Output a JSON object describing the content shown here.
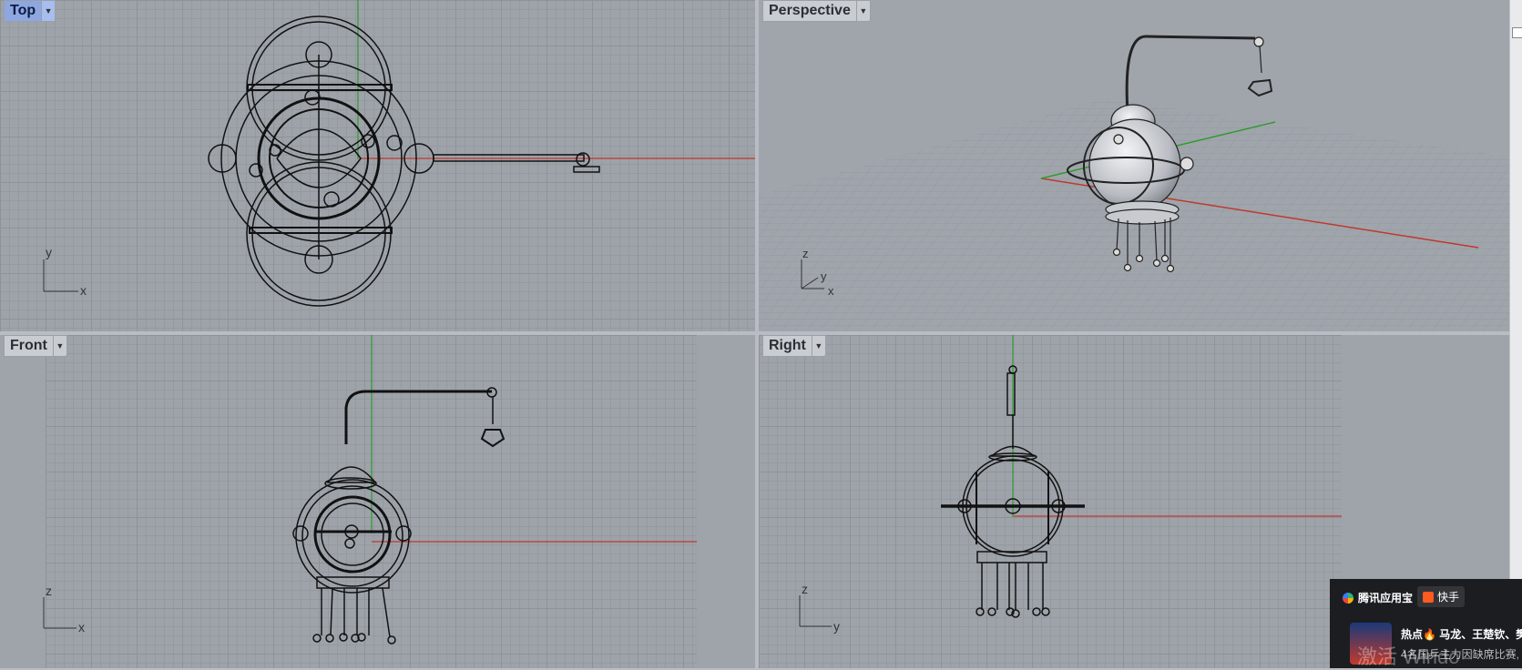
{
  "viewports": {
    "top": {
      "label": "Top"
    },
    "persp": {
      "label": "Perspective"
    },
    "front": {
      "label": "Front"
    },
    "right": {
      "label": "Right"
    }
  },
  "axes": {
    "top": {
      "v": "y",
      "h": "x"
    },
    "persp": {
      "v": "z",
      "a": "y",
      "b": "x"
    },
    "front": {
      "v": "z",
      "h": "x"
    },
    "right": {
      "v": "z",
      "h": "y"
    }
  },
  "toast": {
    "brand": "腾讯应用宝",
    "app": "快手",
    "headline": "热点🔥 马龙、王楚钦、樊",
    "subtext": "4名国乒主力因缺席比赛,"
  },
  "watermark": "激活 Windo",
  "colors": {
    "active_label": "#8ea7e0",
    "x_axis": "#c0392b",
    "y_axis": "#2e9a2e"
  }
}
